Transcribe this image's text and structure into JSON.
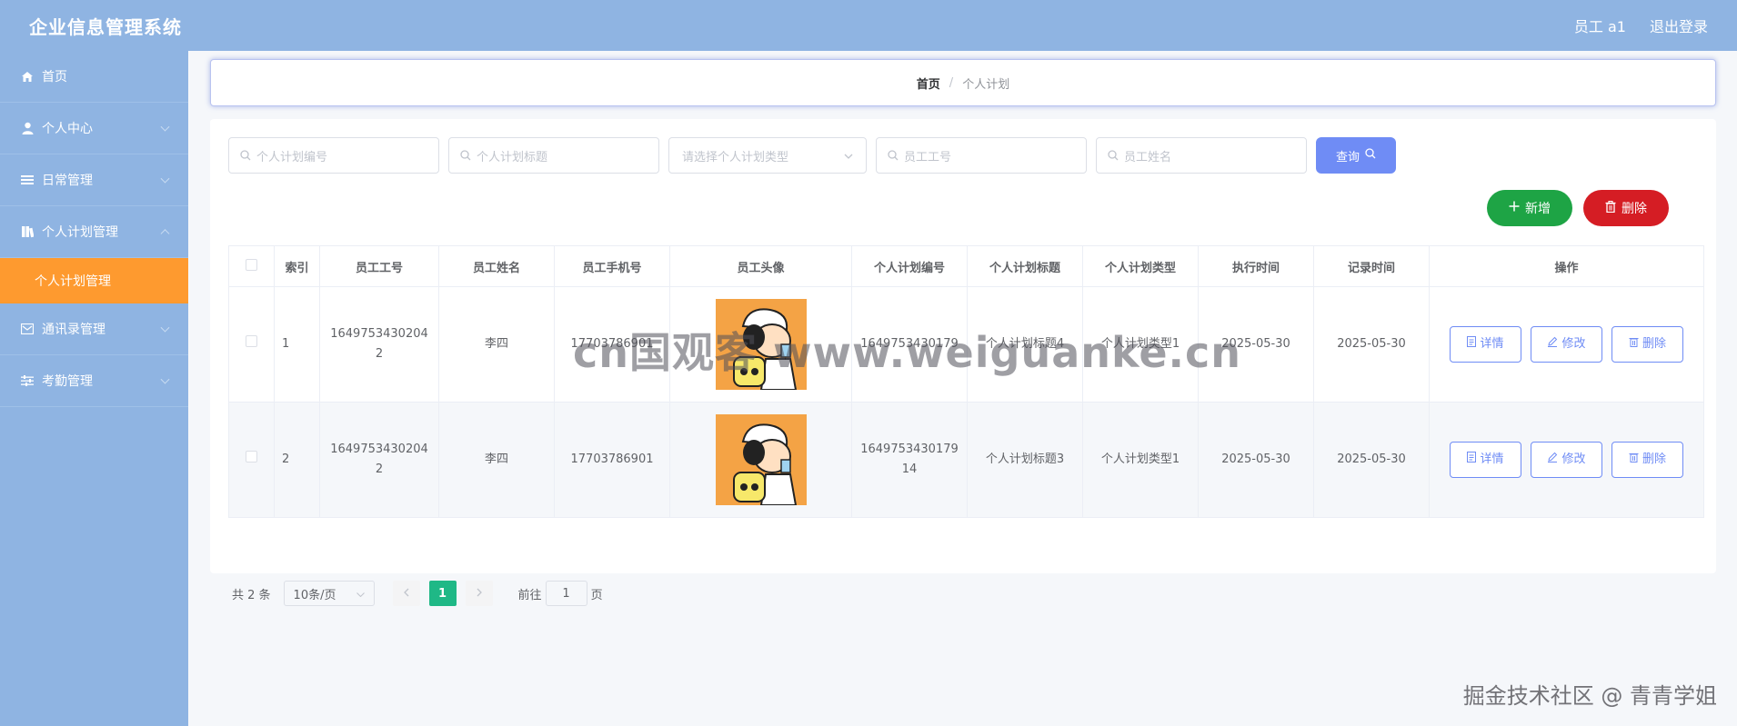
{
  "header": {
    "app_title": "企业信息管理系统",
    "user_label": "员工 a1",
    "logout_label": "退出登录"
  },
  "sidebar": {
    "items": [
      {
        "label": "首页",
        "icon": "home-icon"
      },
      {
        "label": "个人中心",
        "icon": "user-icon"
      },
      {
        "label": "日常管理",
        "icon": "list-icon"
      },
      {
        "label": "个人计划管理",
        "icon": "book-icon"
      },
      {
        "label": "通讯录管理",
        "icon": "contact-icon"
      },
      {
        "label": "考勤管理",
        "icon": "sliders-icon"
      }
    ],
    "active_sub": "个人计划管理"
  },
  "breadcrumb": {
    "home": "首页",
    "separator": "/",
    "current": "个人计划"
  },
  "search": {
    "plan_no_placeholder": "个人计划编号",
    "plan_title_placeholder": "个人计划标题",
    "plan_type_placeholder": "请选择个人计划类型",
    "emp_no_placeholder": "员工工号",
    "emp_name_placeholder": "员工姓名",
    "query_label": "查询"
  },
  "actions": {
    "add_label": "新增",
    "delete_label": "删除"
  },
  "table": {
    "headers": [
      "索引",
      "员工工号",
      "员工姓名",
      "员工手机号",
      "员工头像",
      "个人计划编号",
      "个人计划标题",
      "个人计划类型",
      "执行时间",
      "记录时间",
      "操作"
    ],
    "rows": [
      {
        "index": "1",
        "emp_no": "16497534302042",
        "emp_name": "李四",
        "phone": "17703786901",
        "plan_no": "1649753430179",
        "plan_title": "个人计划标题4",
        "plan_type": "个人计划类型1",
        "exec_time": "2025-05-30",
        "record_time": "2025-05-30"
      },
      {
        "index": "2",
        "emp_no": "16497534302042",
        "emp_name": "李四",
        "phone": "17703786901",
        "plan_no": "164975343017914",
        "plan_title": "个人计划标题3",
        "plan_type": "个人计划类型1",
        "exec_time": "2025-05-30",
        "record_time": "2025-05-30"
      }
    ],
    "op_detail": "详情",
    "op_edit": "修改",
    "op_delete": "删除"
  },
  "pagination": {
    "total": "共 2 条",
    "page_size": "10条/页",
    "current_page": "1",
    "goto_prefix": "前往",
    "goto_value": "1",
    "goto_suffix": "页"
  },
  "watermarks": {
    "center": "cn国观客 www.weiguanke.cn",
    "corner": "掘金技术社区 @ 青青学姐"
  },
  "colors": {
    "header_bg": "#8fb4e2",
    "active_sub_bg": "#fe9a2f",
    "query_btn": "#6f8cf5",
    "add_btn": "#1ea445",
    "delete_btn": "#d51d24",
    "page_active": "#1fb886"
  }
}
